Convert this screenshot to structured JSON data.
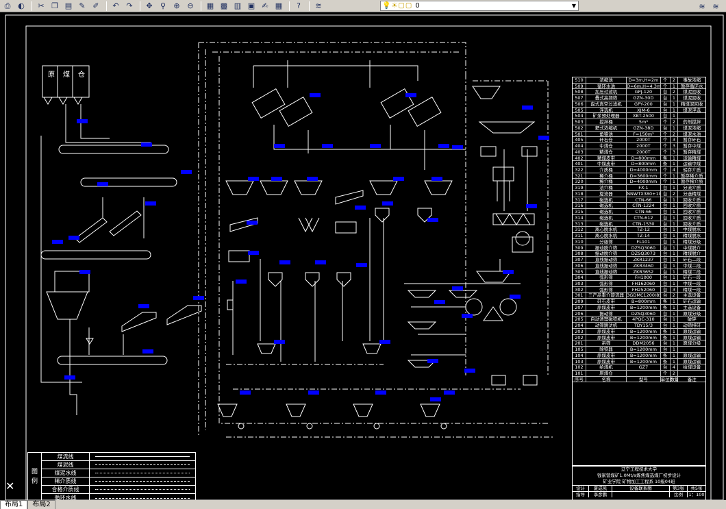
{
  "toolbar": {
    "buttons": [
      "print-preview",
      "plot",
      "cut",
      "copy",
      "paste",
      "match-properties",
      "paint",
      "undo",
      "redo",
      "pan",
      "zoom-realtime",
      "zoom-window",
      "zoom-previous",
      "design-center",
      "properties",
      "tool-palette",
      "sheet-set",
      "markup",
      "quickcalc",
      "help",
      "layer-properties",
      "layer-state"
    ],
    "layer_value": "0"
  },
  "bins": {
    "labels": [
      "原",
      "煤",
      "仓"
    ]
  },
  "legend": {
    "title": [
      "图",
      "例"
    ],
    "items": [
      "煤流线",
      "煤泥线",
      "煤泥水线",
      "稀介质线",
      "合格介质线",
      "循环水线"
    ]
  },
  "parts_table": {
    "rows": [
      [
        "510",
        "浓缩池",
        "D=3m,H=2m",
        "个",
        "2",
        "事故浓缩"
      ],
      [
        "509",
        "循环水池",
        "D=6m,H=4.3m",
        "个",
        "1",
        "暂存循环水"
      ],
      [
        "508",
        "加压过滤机",
        "GPJ-120",
        "台",
        "2",
        "煤泥回收"
      ],
      [
        "507",
        "叠式高频筛",
        "GZN-30D",
        "台",
        "1",
        "煤泥回收"
      ],
      [
        "506",
        "盘式真空过滤机",
        "GPY-200",
        "台",
        "1",
        "精煤泥回收"
      ],
      [
        "505",
        "浮选机",
        "XJM-6",
        "台",
        "1",
        "煤泥浮选"
      ],
      [
        "504",
        "矿浆预处理器",
        "XBT-2500",
        "台",
        "1",
        ""
      ],
      [
        "503",
        "搅拌桶",
        "5m³",
        "个",
        "2",
        "药剂搅拌"
      ],
      [
        "502",
        "耙式浓缩机",
        "GZN-38D",
        "台",
        "1",
        "煤泥浓缩"
      ],
      [
        "501",
        "角锥池",
        "F=150m²",
        "个",
        "2",
        "煤泥水池"
      ],
      [
        "405",
        "矸石仓",
        "2000T",
        "个",
        "3",
        "暂存矸石"
      ],
      [
        "404",
        "中煤仓",
        "2000T",
        "个",
        "3",
        "暂存中煤"
      ],
      [
        "403",
        "精煤仓",
        "2000T",
        "个",
        "3",
        "暂存精煤"
      ],
      [
        "402",
        "精煤皮带",
        "D=800mm",
        "条",
        "1",
        "运输精煤"
      ],
      [
        "401",
        "中煤皮带",
        "D=800mm",
        "条",
        "1",
        "运输中煤"
      ],
      [
        "322",
        "介质桶",
        "D=4000mm",
        "个",
        "4",
        "储存介质"
      ],
      [
        "321",
        "稀介桶",
        "D=3600mm",
        "个",
        "1",
        "暂存稀介质"
      ],
      [
        "320",
        "稀介桶",
        "D=4000mm",
        "个",
        "1",
        "暂存稀介质"
      ],
      [
        "319",
        "浓介桶",
        "FX-1",
        "台",
        "1",
        "分流介质"
      ],
      [
        "318",
        "旋流器",
        "NNWTX380+18",
        "台",
        "2",
        "分选精煤"
      ],
      [
        "317",
        "磁选机",
        "CTN-66",
        "台",
        "1",
        "回收介质"
      ],
      [
        "316",
        "磁选机",
        "CTN-1224",
        "台",
        "1",
        "回收介质"
      ],
      [
        "315",
        "磁选机",
        "CTN-66",
        "台",
        "1",
        "回收介质"
      ],
      [
        "314",
        "磁选机",
        "CTN-612",
        "台",
        "1",
        "回收介质"
      ],
      [
        "313",
        "磁选机",
        "CTN-1530",
        "台",
        "1",
        "回收介质"
      ],
      [
        "312",
        "离心脱水机",
        "TZ-12",
        "台",
        "1",
        "中煤脱水"
      ],
      [
        "311",
        "离心脱水机",
        "TZ-14",
        "台",
        "1",
        "精煤脱水"
      ],
      [
        "310",
        "分级筛",
        "FL101",
        "台",
        "1",
        "精煤分级"
      ],
      [
        "309",
        "振动脱介筛",
        "DZSQ3060",
        "台",
        "1",
        "中煤脱介"
      ],
      [
        "308",
        "振动脱介筛",
        "DZSQ3073",
        "台",
        "1",
        "精煤脱介"
      ],
      [
        "307",
        "直线振动筛",
        "ZKR1237",
        "台",
        "1",
        "矸石二段"
      ],
      [
        "306",
        "直线振动筛",
        "ZKR3460",
        "台",
        "1",
        "中煤二段"
      ],
      [
        "305",
        "直线振动筛",
        "ZKR3652",
        "台",
        "1",
        "精煤二段"
      ],
      [
        "304",
        "弧形筛",
        "FH1000",
        "台",
        "1",
        "矸石一段"
      ],
      [
        "303",
        "弧形筛",
        "FH162060",
        "台",
        "1",
        "中煤一段"
      ],
      [
        "302",
        "弧形筛",
        "FH252060",
        "台",
        "3",
        "精煤一段"
      ],
      [
        "301",
        "三产品重介旋流器",
        "3GDMC1200/850",
        "台",
        "2",
        "主选设备"
      ],
      [
        "209",
        "矸石皮带",
        "B=800mm",
        "条",
        "1",
        "矸石运输"
      ],
      [
        "207",
        "原煤皮带",
        "B=1200mm",
        "条",
        "1",
        "主选设备"
      ],
      [
        "206",
        "振动筛",
        "DZSQ3060",
        "台",
        "1",
        "原煤分级"
      ],
      [
        "205",
        "自动清理磁铁机",
        "4PQC-310",
        "台",
        "1",
        "破碎"
      ],
      [
        "204",
        "动筛跳汰机",
        "TDY15/3",
        "台",
        "1",
        "动筛排矸"
      ],
      [
        "203",
        "原煤皮带",
        "B=1200mm",
        "条",
        "1",
        "原煤运输"
      ],
      [
        "202",
        "原煤皮带",
        "B=1200mm",
        "条",
        "1",
        "原煤运输"
      ],
      [
        "201",
        "吊筛",
        "DDM2056",
        "台",
        "1",
        "原煤分级"
      ],
      [
        "105",
        "除铁器",
        "B=1200mm",
        "台",
        "1",
        ""
      ],
      [
        "104",
        "原煤皮带",
        "B=1200mm",
        "条",
        "1",
        "原煤运输"
      ],
      [
        "103",
        "原煤皮带",
        "B=1200mm",
        "条",
        "1",
        "原煤运输"
      ],
      [
        "102",
        "给煤机",
        "GZ7",
        "台",
        "4",
        "给煤设备"
      ],
      [
        "101",
        "原煤仓",
        "",
        "个",
        "2",
        ""
      ]
    ],
    "header": [
      "序号",
      "名称",
      "型号",
      "单位",
      "数量",
      "备注"
    ]
  },
  "title_block": {
    "school": "辽宁工程技术大学",
    "project": "钱家营煤矿1.0Mt/a炼焦煤选煤厂初步设计",
    "dept": "矿业学院 矿物加工工程系 10级04班",
    "designer_label": "设计",
    "designer": "夏成凯",
    "checker_label": "指导",
    "checker": "李彦鹏",
    "drawing": "设备联系图",
    "sheet_label": "第3张",
    "total_label": "共5张",
    "scale_label": "比例",
    "scale": "1：100"
  },
  "tabs": [
    "布局1",
    "布局2"
  ],
  "colors": {
    "tag": "#0000ff",
    "line": "#ffffff",
    "bg": "#000000"
  }
}
